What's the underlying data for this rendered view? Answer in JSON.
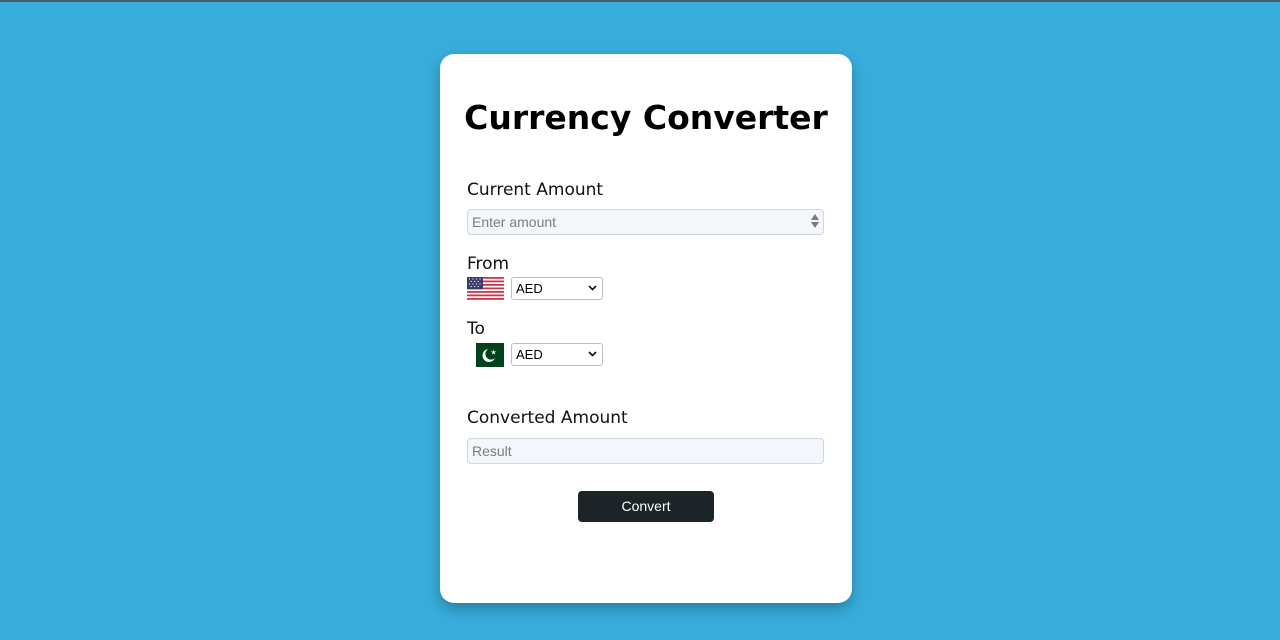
{
  "app": {
    "title": "Currency Converter"
  },
  "form": {
    "current_amount_label": "Current Amount",
    "amount_placeholder": "Enter amount",
    "from_label": "From",
    "from_currency": "AED",
    "from_flag": "us-flag-icon",
    "to_label": "To",
    "to_currency": "AED",
    "to_flag": "pakistan-flag-icon",
    "converted_label": "Converted Amount",
    "result_placeholder": "Result",
    "convert_button": "Convert"
  },
  "colors": {
    "background": "#38addc",
    "card": "#ffffff",
    "button": "#1c2428"
  }
}
